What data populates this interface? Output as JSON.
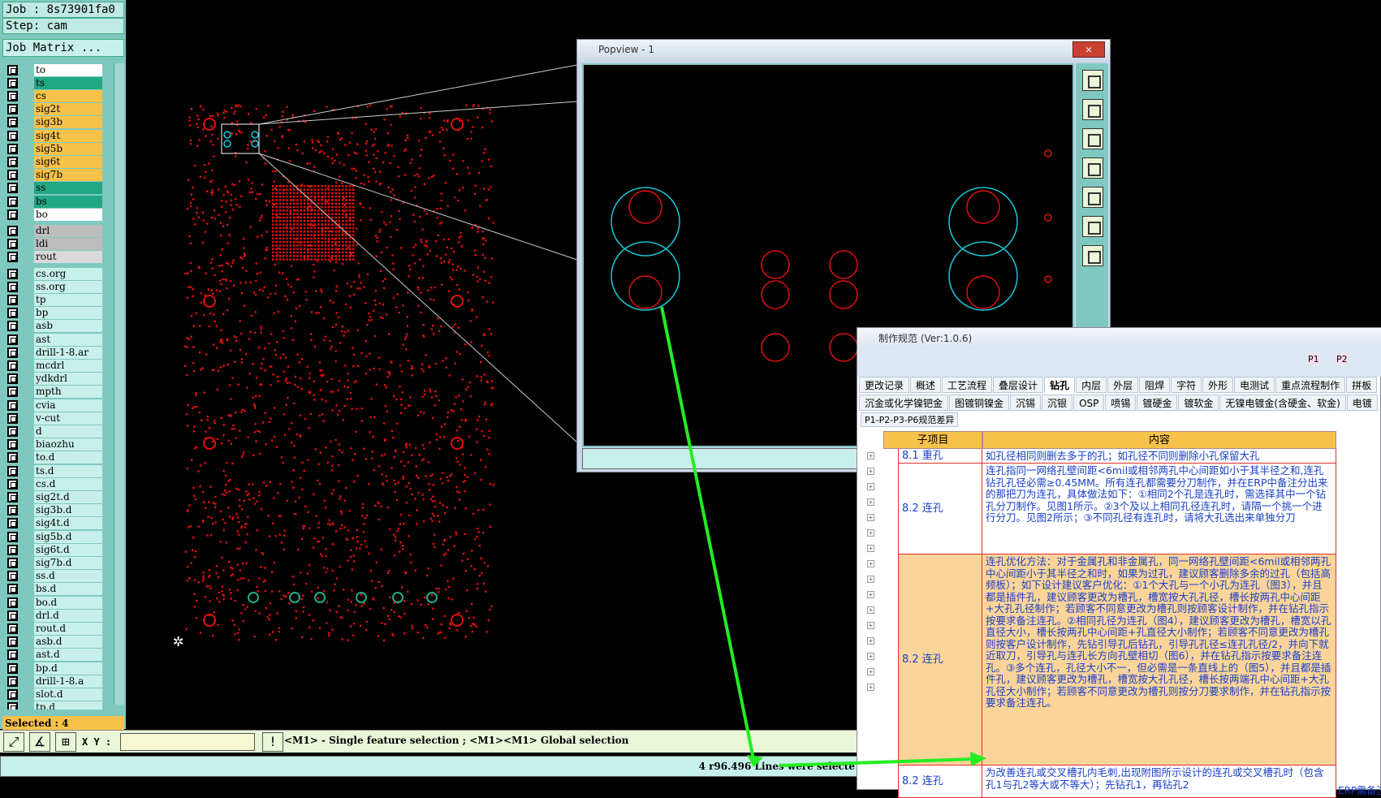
{
  "left_panel": {
    "job_label": "Job : 8s73901fa0",
    "step_label": "Step: cam",
    "job_matrix_button": "Job Matrix ...",
    "selected_label": "Selected : 4",
    "layers": [
      {
        "name": "to",
        "color": "#ffffff"
      },
      {
        "name": "ts",
        "color": "#21a883"
      },
      {
        "name": "cs",
        "color": "#f7c24a"
      },
      {
        "name": "sig2t",
        "color": "#f7c24a"
      },
      {
        "name": "sig3b",
        "color": "#f7c24a"
      },
      {
        "name": "sig4t",
        "color": "#f7c24a"
      },
      {
        "name": "sig5b",
        "color": "#f7c24a"
      },
      {
        "name": "sig6t",
        "color": "#f7c24a"
      },
      {
        "name": "sig7b",
        "color": "#f7c24a"
      },
      {
        "name": "ss",
        "color": "#21a883"
      },
      {
        "name": "bs",
        "color": "#21a883"
      },
      {
        "name": "bo",
        "color": "#ffffff"
      },
      {
        "name": "drl",
        "color": "#bdbdbd",
        "gap": true
      },
      {
        "name": "ldi",
        "color": "#bdbdbd"
      },
      {
        "name": "rout",
        "color": "#d9d9d9"
      },
      {
        "name": "cs.org",
        "color": "#c8f0ea",
        "gap": true
      },
      {
        "name": "ss.org",
        "color": "#c8f0ea"
      },
      {
        "name": "tp",
        "color": "#c8f0ea"
      },
      {
        "name": "bp",
        "color": "#c8f0ea"
      },
      {
        "name": "asb",
        "color": "#c8f0ea"
      },
      {
        "name": "ast",
        "color": "#c8f0ea"
      },
      {
        "name": "drill-1-8.ar",
        "color": "#c8f0ea"
      },
      {
        "name": "mcdrl",
        "color": "#c8f0ea"
      },
      {
        "name": "ydkdrl",
        "color": "#c8f0ea"
      },
      {
        "name": "mpth",
        "color": "#c8f0ea"
      },
      {
        "name": "cvia",
        "color": "#c8f0ea"
      },
      {
        "name": "v-cut",
        "color": "#c8f0ea"
      },
      {
        "name": "d",
        "color": "#c8f0ea"
      },
      {
        "name": "biaozhu",
        "color": "#c8f0ea"
      },
      {
        "name": "to.d",
        "color": "#c8f0ea"
      },
      {
        "name": "ts.d",
        "color": "#c8f0ea"
      },
      {
        "name": "cs.d",
        "color": "#c8f0ea"
      },
      {
        "name": "sig2t.d",
        "color": "#c8f0ea"
      },
      {
        "name": "sig3b.d",
        "color": "#c8f0ea"
      },
      {
        "name": "sig4t.d",
        "color": "#c8f0ea"
      },
      {
        "name": "sig5b.d",
        "color": "#c8f0ea"
      },
      {
        "name": "sig6t.d",
        "color": "#c8f0ea"
      },
      {
        "name": "sig7b.d",
        "color": "#c8f0ea"
      },
      {
        "name": "ss.d",
        "color": "#c8f0ea"
      },
      {
        "name": "bs.d",
        "color": "#c8f0ea"
      },
      {
        "name": "bo.d",
        "color": "#c8f0ea"
      },
      {
        "name": "drl.d",
        "color": "#c8f0ea"
      },
      {
        "name": "rout.d",
        "color": "#c8f0ea"
      },
      {
        "name": "asb.d",
        "color": "#c8f0ea"
      },
      {
        "name": "ast.d",
        "color": "#c8f0ea"
      },
      {
        "name": "bp.d",
        "color": "#c8f0ea"
      },
      {
        "name": "drill-1-8.a",
        "color": "#c8f0ea"
      },
      {
        "name": "slot.d",
        "color": "#c8f0ea"
      },
      {
        "name": "tp.d",
        "color": "#c8f0ea"
      }
    ]
  },
  "bottom_bar": {
    "xy_label": "X Y :",
    "xy_value": "",
    "message": "<M1> - Single feature selection ; <M1><M1> Global selection",
    "status": "4 r96.496 Lines were selecte"
  },
  "popview": {
    "title": "Popview - 1",
    "close_button": "Clos"
  },
  "spec_window": {
    "title": "制作规范 (Ver:1.0.6)",
    "page_tags": [
      "P1",
      "P2"
    ],
    "tabs_row1": [
      "更改记录",
      "概述",
      "工艺流程",
      "叠层设计",
      "钻孔",
      "内层",
      "外层",
      "阻焊",
      "字符",
      "外形",
      "电测试",
      "重点流程制作",
      "拼板"
    ],
    "active_tab": "钻孔",
    "tabs_row2": [
      "沉金或化学镍钯金",
      "图镀铜镍金",
      "沉锡",
      "沉银",
      "OSP",
      "喷锡",
      "镀硬金",
      "镀软金",
      "无镍电镀金(含硬金、软金)",
      "电镀"
    ],
    "sub_tab": "P1-P2-P3-P6规范差异",
    "col_item": "子项目",
    "col_content": "内容",
    "rows": [
      {
        "key": "8.1 重孔",
        "text": "如孔径相同则删去多于的孔；如孔径不同则删除小孔保留大孔"
      },
      {
        "key": "8.2 连孔",
        "text": "连孔指同一网络孔壁间距<6mil或相邻两孔中心间距如小于其半径之和,连孔钻孔孔径必需≥0.45MM。所有连孔都需要分刀制作，并在ERP中备注分出来的那把刀为连孔，具体做法如下：①相同2个孔是连孔时，需选择其中一个钻孔分刀制作。见图1所示。②3个及以上相同孔径连孔时，请隔一个挑一个进行分刀。见图2所示；③不同孔径有连孔时，请将大孔选出来单独分刀"
      },
      {
        "key": "8.2 连孔",
        "text": "连孔优化方法：对于金属孔和非金属孔，同一网络孔壁间距<6mil或相邻两孔中心间距小于其半径之和时，如果为过孔，建议顾客删除多余的过孔（包括高频板）；如下设计建议客户优化：①1个大孔与一个小孔为连孔（图3），并且都是插件孔，建议顾客更改为槽孔，槽宽按大孔孔径，槽长按两孔中心间距+大孔孔径制作；若顾客不同意更改为槽孔则按顾客设计制作，并在钻孔指示按要求备注连孔。②相同孔径为连孔（图4），建议顾客更改为槽孔，槽宽以孔直径大小，槽长按两孔中心间距+孔直径大小制作；若顾客不同意更改为槽孔则按客户设计制作，先钻引导孔后钻孔，引导孔孔径≤连孔孔径/2，并向下就近取刀，引导孔与连孔长方向孔壁相切（图6），并在钻孔指示按要求备注连孔。③多个连孔，孔径大小不一，但必需是一条直线上的（图5），并且都是插件孔，建议顾客更改为槽孔，槽宽按大孔孔径，槽长按两端孔中心间距+大孔孔径大小制作；若顾客不同意更改为槽孔则按分刀要求制作，并在钻孔指示按要求备注连孔。"
      },
      {
        "key": "8.2 连孔",
        "text": "为改善连孔或交叉槽孔内毛刺,出现附图所示设计的连孔或交叉槽孔时（包含孔1与孔2等大或不等大）；先钻孔1，再钻孔2"
      }
    ],
    "extra_col": "ERP需备注"
  },
  "colors": {
    "accent": "#7fc8c0",
    "pad": "#e01010",
    "cyan": "#19c8d8",
    "arrow": "#22ee22"
  }
}
